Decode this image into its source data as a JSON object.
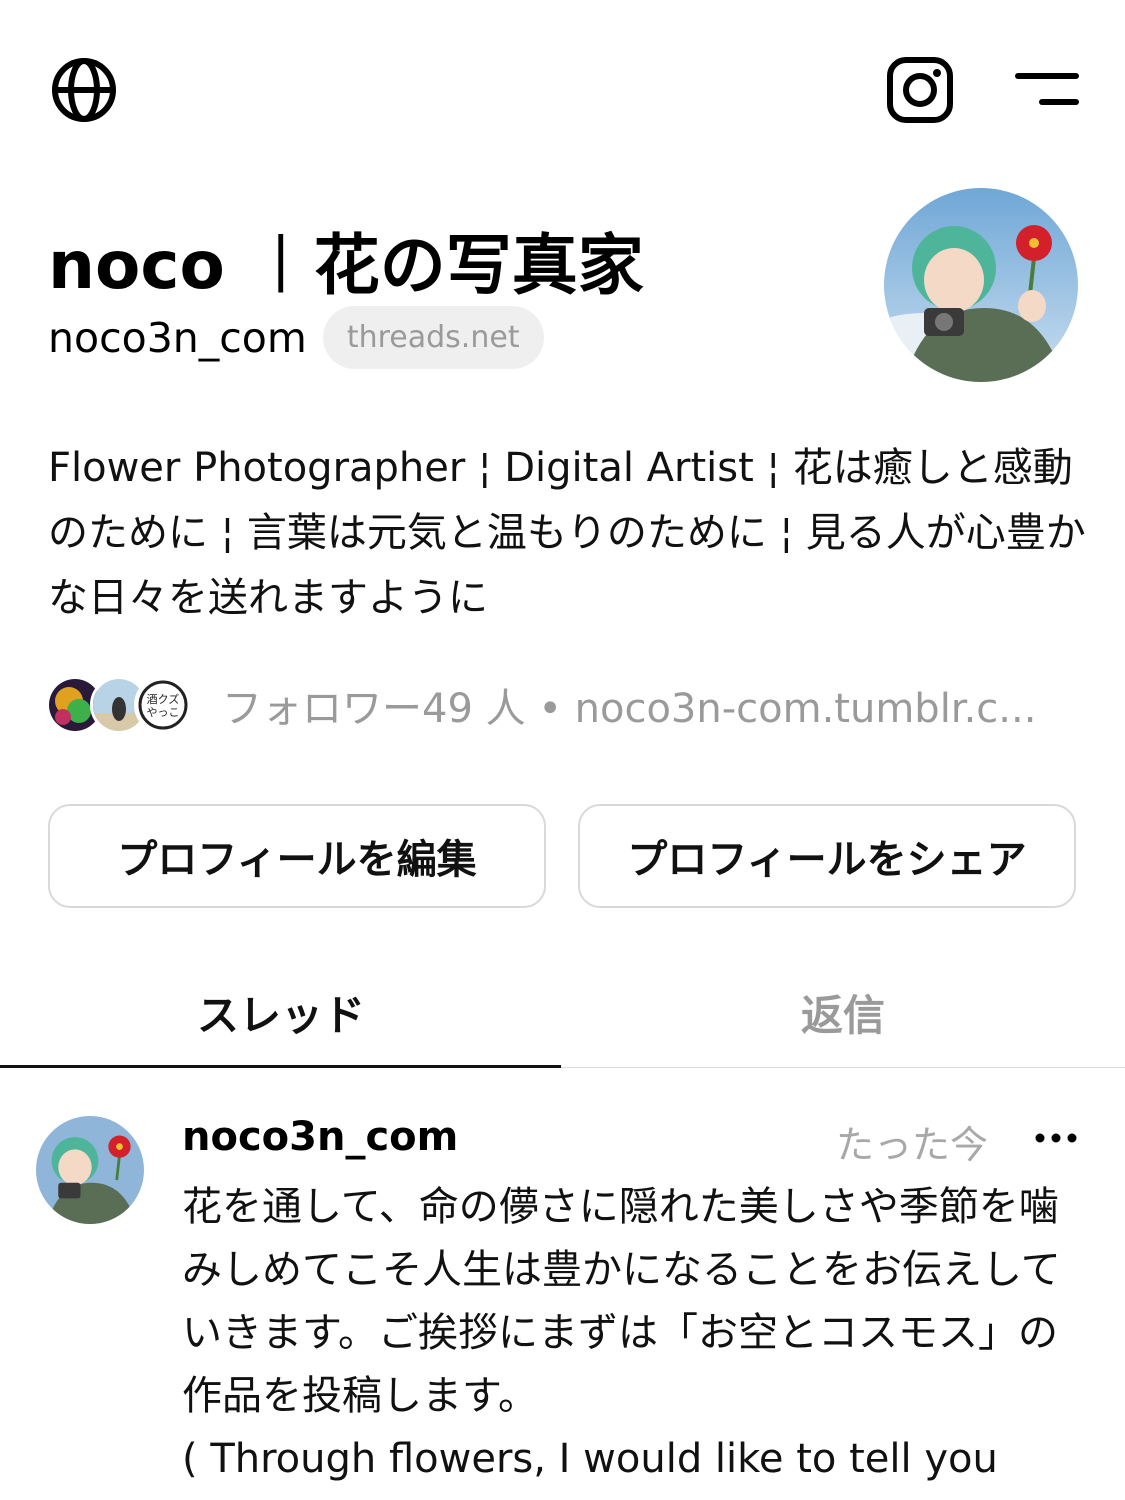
{
  "header": {
    "icons": [
      "globe-icon",
      "instagram-icon",
      "menu-icon"
    ]
  },
  "profile": {
    "display_name": "noco ︱花の写真家",
    "username": "noco3n_com",
    "domain_badge": "threads.net",
    "bio": "Flower Photographer ¦ Digital Artist ¦ 花は癒しと感動のために ¦ 言葉は元気と温もりのために ¦ 見る人が心豊かな日々を送れますように",
    "followers_text": "フォロワー49 人 • noco3n-com.tumblr.c...",
    "follower_avatar_3_label": "酒クズやっこ"
  },
  "actions": {
    "edit_label": "プロフィールを編集",
    "share_label": "プロフィールをシェア"
  },
  "tabs": [
    {
      "label": "スレッド",
      "active": true
    },
    {
      "label": "返信",
      "active": false
    }
  ],
  "post": {
    "username": "noco3n_com",
    "time": "たった今",
    "body": "花を通して、命の儚さに隠れた美しさや季節を噛みしめてこそ人生は豊かになることをお伝えしていきます。ご挨拶にまずは「お空とコスモス」の作品を投稿します。",
    "body_en": "( Through flowers, I would like to tell you"
  },
  "colors": {
    "accent": "#111111",
    "muted": "#9a9a9a",
    "chip_bg": "#efefef",
    "border": "#d9d9d9"
  }
}
